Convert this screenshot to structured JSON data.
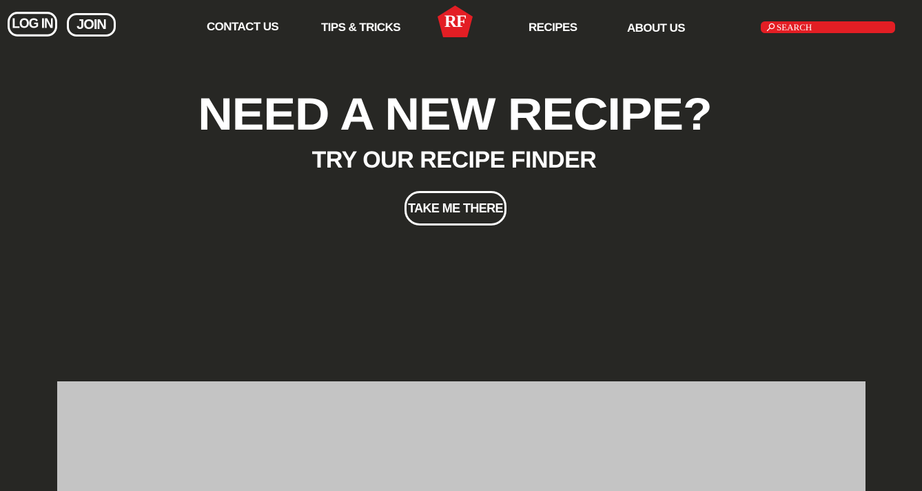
{
  "header": {
    "login_label": "LOG IN",
    "join_label": "JOIN",
    "nav": {
      "contact": "CONTACT US",
      "tips": "TIPS & TRICKS",
      "recipes": "RECIPES",
      "about": "ABOUT US"
    },
    "logo_text": "RF",
    "search": {
      "placeholder": "SEARCH",
      "value": ""
    }
  },
  "hero": {
    "title": "NEED A NEW RECIPE?",
    "subtitle": "TRY OUR RECIPE FINDER",
    "cta_label": "TAKE ME THERE"
  },
  "colors": {
    "background": "#272724",
    "accent": "#e31e24",
    "placeholder_panel": "#c4c4c4"
  },
  "icons": {
    "search": "search-icon",
    "logo": "pentagon-logo-icon"
  }
}
